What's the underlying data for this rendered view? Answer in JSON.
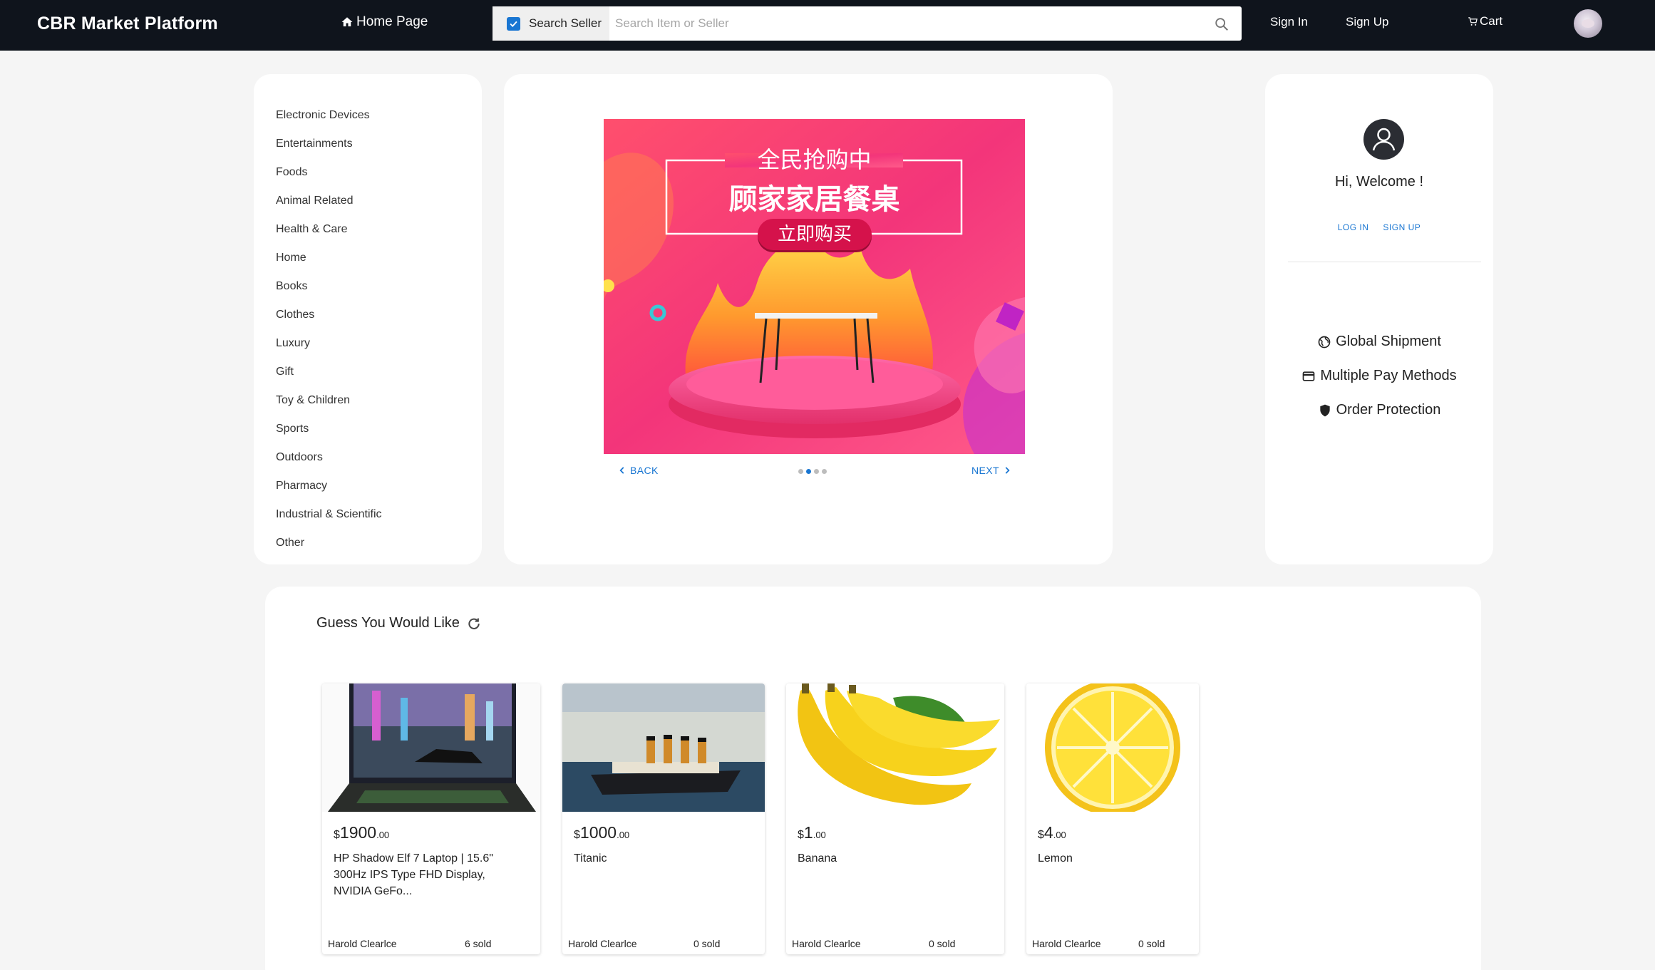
{
  "header": {
    "brand": "CBR Market Platform",
    "home_label": "Home Page",
    "search_seller_label": "Search Seller",
    "search_placeholder": "Search Item or Seller",
    "sign_in": "Sign In",
    "sign_up": "Sign Up",
    "cart": "Cart"
  },
  "categories": [
    "Electronic Devices",
    "Entertainments",
    "Foods",
    "Animal Related",
    "Health & Care",
    "Home",
    "Books",
    "Clothes",
    "Luxury",
    "Gift",
    "Toy & Children",
    "Sports",
    "Outdoors",
    "Pharmacy",
    "Industrial & Scientific",
    "Other"
  ],
  "carousel": {
    "banner_line1": "全民抢购中",
    "banner_line2": "顾家家居餐桌",
    "banner_button": "立即购买",
    "back_label": "BACK",
    "next_label": "NEXT",
    "active_dot": 1,
    "dot_count": 4
  },
  "welcome": {
    "greeting": "Hi, Welcome !",
    "login": "LOG IN",
    "signup": "SIGN UP",
    "features": [
      {
        "label": "Global Shipment",
        "icon": "globe-icon"
      },
      {
        "label": "Multiple Pay Methods",
        "icon": "credit-card-icon"
      },
      {
        "label": "Order Protection",
        "icon": "shield-icon"
      }
    ]
  },
  "guess": {
    "title": "Guess You Would Like",
    "products": [
      {
        "currency": "$",
        "price_int": "1900",
        "price_dec": ".00",
        "name": "HP Shadow Elf 7 Laptop | 15.6\" 300Hz IPS Type FHD Display, NVIDIA GeFo...",
        "seller": "Harold Clearlce",
        "sold": "6 sold"
      },
      {
        "currency": "$",
        "price_int": "1000",
        "price_dec": ".00",
        "name": "Titanic",
        "seller": "Harold Clearlce",
        "sold": "0 sold"
      },
      {
        "currency": "$",
        "price_int": "1",
        "price_dec": ".00",
        "name": "Banana",
        "seller": "Harold Clearlce",
        "sold": "0 sold"
      },
      {
        "currency": "$",
        "price_int": "4",
        "price_dec": ".00",
        "name": "Lemon",
        "seller": "Harold Clearlce",
        "sold": "0 sold"
      }
    ]
  }
}
